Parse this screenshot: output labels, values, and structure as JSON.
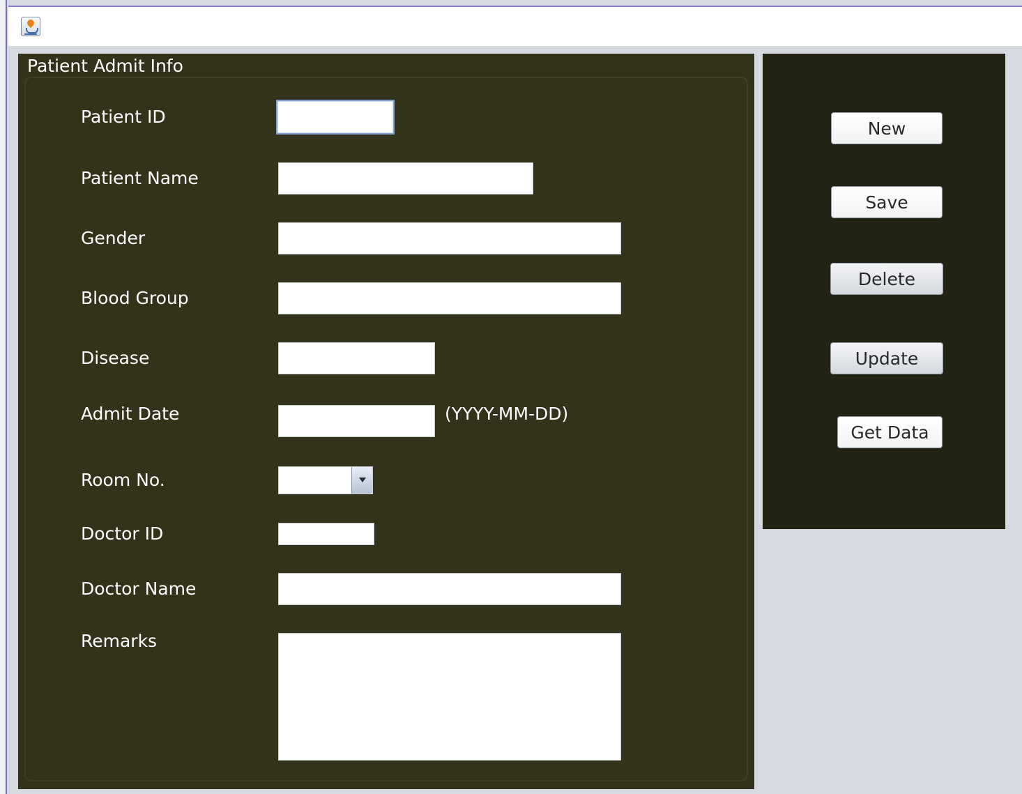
{
  "window": {
    "icon": "java-app-icon"
  },
  "form": {
    "title": "Patient Admit Info",
    "fields": {
      "patient_id": {
        "label": "Patient ID",
        "value": ""
      },
      "patient_name": {
        "label": "Patient Name",
        "value": ""
      },
      "gender": {
        "label": "Gender",
        "value": ""
      },
      "blood_group": {
        "label": "Blood Group",
        "value": ""
      },
      "disease": {
        "label": "Disease",
        "value": ""
      },
      "admit_date": {
        "label": "Admit Date",
        "value": "",
        "hint": "(YYYY-MM-DD)"
      },
      "room_no": {
        "label": "Room No.",
        "value": ""
      },
      "doctor_id": {
        "label": "Doctor ID",
        "value": ""
      },
      "doctor_name": {
        "label": "Doctor Name",
        "value": ""
      },
      "remarks": {
        "label": "Remarks",
        "value": ""
      }
    }
  },
  "actions": {
    "new": "New",
    "save": "Save",
    "delete": "Delete",
    "update": "Update",
    "get_data": "Get Data"
  },
  "colors": {
    "form_panel": "#33331b",
    "action_panel": "#232313",
    "window_background": "#d6d9e0"
  }
}
